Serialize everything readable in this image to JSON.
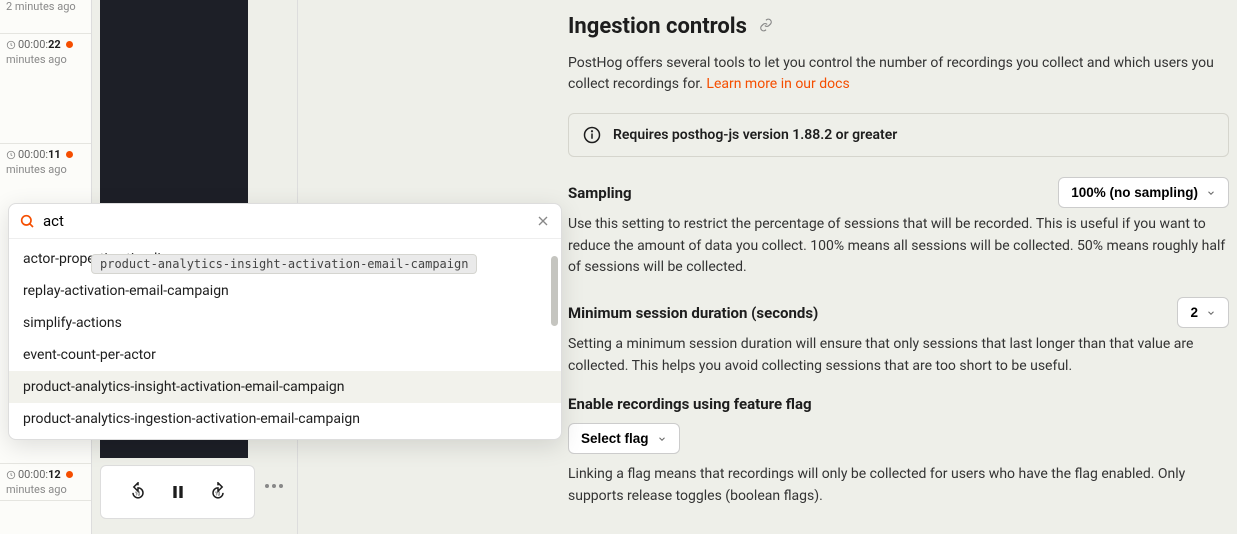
{
  "sessions": [
    {
      "seconds": "",
      "ago": "2 minutes ago",
      "showDuration": false
    },
    {
      "prefix": "00:00:",
      "seconds": "22",
      "ago": "minutes ago",
      "showDuration": true
    },
    {
      "prefix": "00:00:",
      "seconds": "11",
      "ago": "minutes ago",
      "showDuration": true
    },
    {
      "prefix": "00:00:",
      "seconds": "12",
      "ago": "minutes ago",
      "showDuration": true
    }
  ],
  "page": {
    "title": "Ingestion controls",
    "description": "PostHog offers several tools to let you control the number of recordings you collect and which users you collect recordings for. ",
    "docsLink": "Learn more in our docs",
    "bannerText": "Requires posthog-js version 1.88.2 or greater"
  },
  "sampling": {
    "title": "Sampling",
    "valueLabel": "100% (no sampling)",
    "desc": "Use this setting to restrict the percentage of sessions that will be recorded. This is useful if you want to reduce the amount of data you collect. 100% means all sessions will be collected. 50% means roughly half of sessions will be collected."
  },
  "minDuration": {
    "title": "Minimum session duration (seconds)",
    "valueLabel": "2",
    "desc": "Setting a minimum session duration will ensure that only sessions that last longer than that value are collected. This helps you avoid collecting sessions that are too short to be useful."
  },
  "featureFlag": {
    "title": "Enable recordings using feature flag",
    "buttonLabel": "Select flag",
    "desc": "Linking a flag means that recordings will only be collected for users who have the flag enabled. Only supports release toggles (boolean flags)."
  },
  "search": {
    "query": "act",
    "tooltip": "product-analytics-insight-activation-email-campaign",
    "results": [
      "actor-properties-timeline",
      "replay-activation-email-campaign",
      "simplify-actions",
      "event-count-per-actor",
      "product-analytics-insight-activation-email-campaign",
      "product-analytics-ingestion-activation-email-campaign"
    ],
    "highlightedIndex": 4
  }
}
